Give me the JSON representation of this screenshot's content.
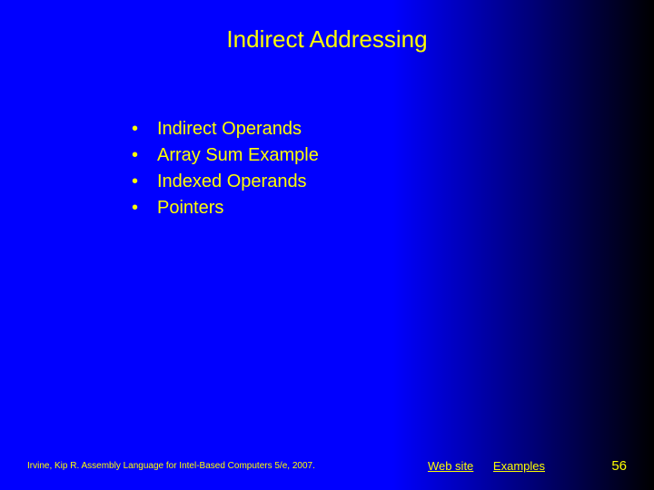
{
  "title": "Indirect Addressing",
  "bullets": [
    "Indirect Operands",
    "Array Sum Example",
    "Indexed Operands",
    "Pointers"
  ],
  "footer": {
    "credit": "Irvine, Kip R. Assembly Language for Intel-Based Computers 5/e, 2007.",
    "link1": "Web site",
    "link2": "Examples",
    "page": "56"
  }
}
